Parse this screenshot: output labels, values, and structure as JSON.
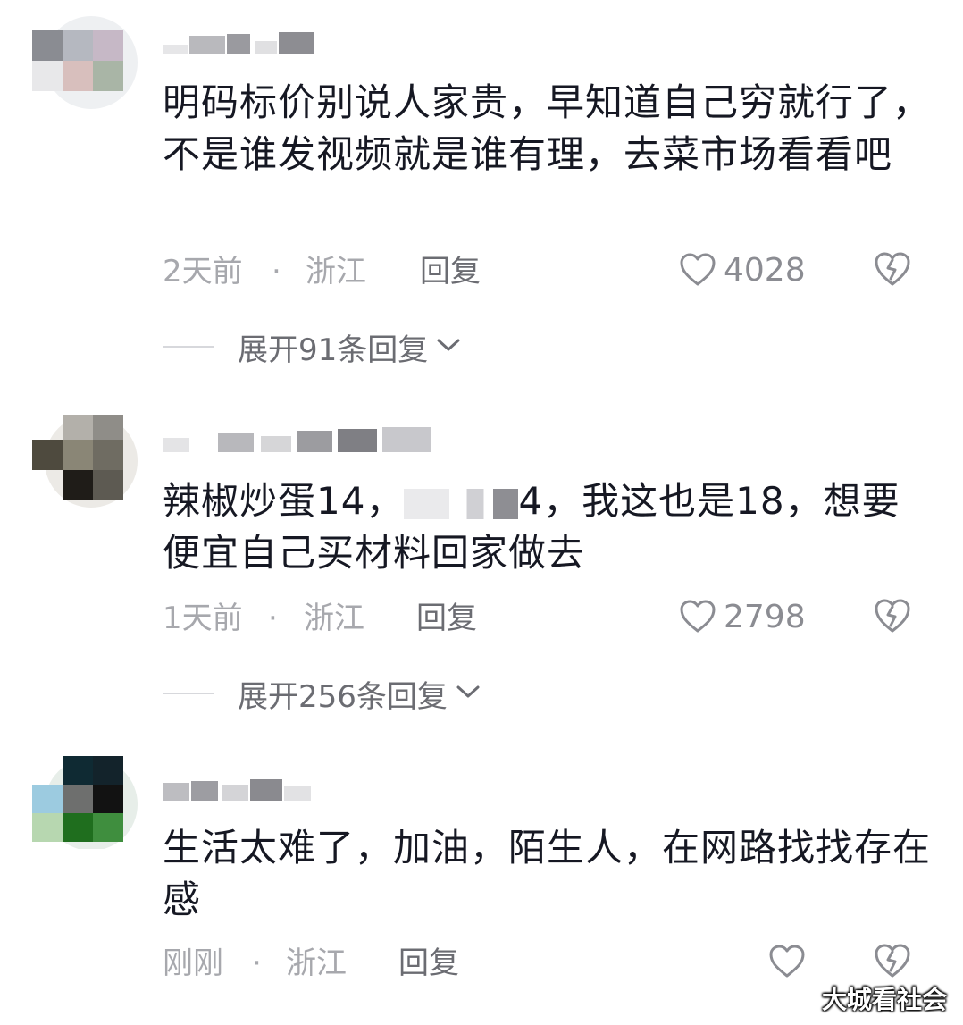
{
  "colors": {
    "text": "#161823",
    "meta": "#a7a8ad",
    "secondary": "#6b6c72"
  },
  "comments": [
    {
      "text": "明码标价别说人家贵，早知道自己穷就行了，不是谁发视频就是谁有理，去菜市场看看吧",
      "time": "2天前",
      "separator": "·",
      "location": "浙江",
      "reply_label": "回复",
      "likes": "4028",
      "expand_label": "展开91条回复",
      "like_icon": "heart-outline-icon",
      "dislike_icon": "broken-heart-icon"
    },
    {
      "text_before": "辣椒炒蛋14，",
      "text_after": "4，我这也是18，想要便宜自己买材料回家做去",
      "time": "1天前",
      "separator": "·",
      "location": "浙江",
      "reply_label": "回复",
      "likes": "2798",
      "expand_label": "展开256条回复",
      "like_icon": "heart-outline-icon",
      "dislike_icon": "broken-heart-icon"
    },
    {
      "text": "生活太难了，加油，陌生人，在网路找找存在感",
      "time": "刚刚",
      "separator": "·",
      "location": "浙江",
      "reply_label": "回复",
      "like_icon": "heart-outline-icon",
      "dislike_icon": "broken-heart-icon"
    }
  ],
  "watermark": "大城看社会"
}
